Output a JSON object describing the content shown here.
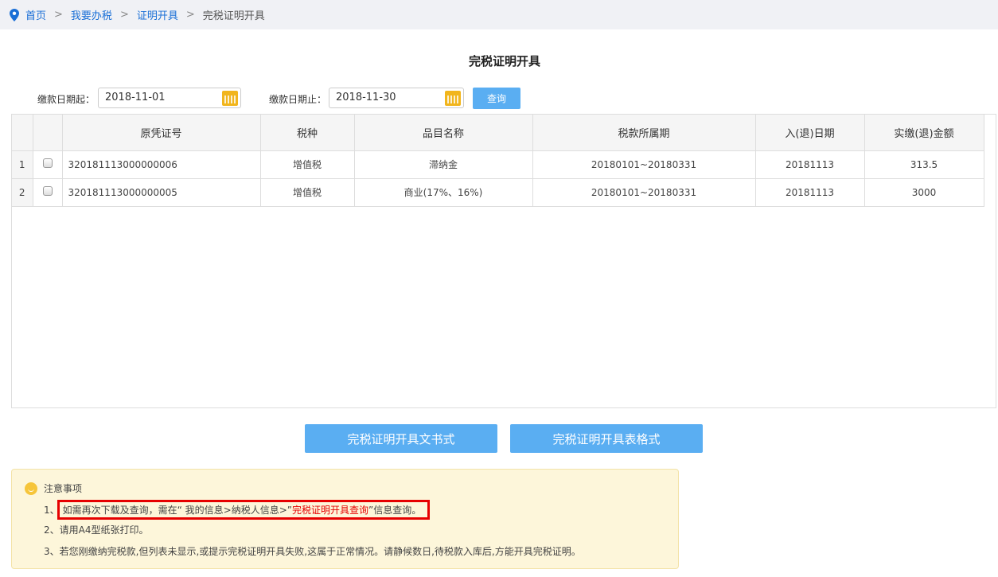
{
  "breadcrumb": {
    "items": [
      "首页",
      "我要办税",
      "证明开具"
    ],
    "current": "完税证明开具",
    "separator": ">"
  },
  "page_title": "完税证明开具",
  "filter": {
    "start_label": "缴款日期起：",
    "start_value": "2018-11-01",
    "end_label": "缴款日期止：",
    "end_value": "2018-11-30",
    "query_label": "查询"
  },
  "table": {
    "headers": [
      "原凭证号",
      "税种",
      "品目名称",
      "税款所属期",
      "入(退)日期",
      "实缴(退)金额"
    ],
    "rows": [
      {
        "num": "1",
        "voucher": "320181113000000006",
        "tax": "增值税",
        "item": "滞纳金",
        "period": "20180101~20180331",
        "date": "20181113",
        "amount": "313.5"
      },
      {
        "num": "2",
        "voucher": "320181113000000005",
        "tax": "增值税",
        "item": "商业(17%、16%)",
        "period": "20180101~20180331",
        "date": "20181113",
        "amount": "3000"
      }
    ]
  },
  "actions": {
    "doc_format": "完税证明开具文书式",
    "table_format": "完税证明开具表格式"
  },
  "notice": {
    "title": "注意事项",
    "item1_prefix": "1、",
    "item1_text": "如需再次下载及查询，需在“ 我的信息>纳税人信息>”",
    "item1_link": "完税证明开具查询",
    "item1_suffix": "”信息查询。",
    "item2": "2、请用A4型纸张打印。",
    "item3": "3、若您刚缴纳完税款,但列表未显示,或提示完税证明开具失败,这属于正常情况。请静候数日,待税款入库后,方能开具完税证明。"
  }
}
